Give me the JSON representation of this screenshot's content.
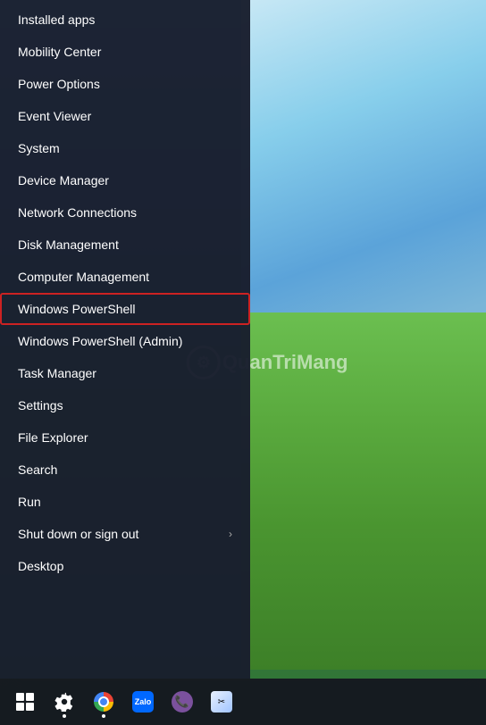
{
  "desktop": {
    "watermark_text": "QuanTriMang"
  },
  "context_menu": {
    "items": [
      {
        "id": "installed-apps",
        "label": "Installed apps",
        "arrow": false,
        "highlighted": false
      },
      {
        "id": "mobility-center",
        "label": "Mobility Center",
        "arrow": false,
        "highlighted": false
      },
      {
        "id": "power-options",
        "label": "Power Options",
        "arrow": false,
        "highlighted": false
      },
      {
        "id": "event-viewer",
        "label": "Event Viewer",
        "arrow": false,
        "highlighted": false
      },
      {
        "id": "system",
        "label": "System",
        "arrow": false,
        "highlighted": false
      },
      {
        "id": "device-manager",
        "label": "Device Manager",
        "arrow": false,
        "highlighted": false
      },
      {
        "id": "network-connections",
        "label": "Network Connections",
        "arrow": false,
        "highlighted": false
      },
      {
        "id": "disk-management",
        "label": "Disk Management",
        "arrow": false,
        "highlighted": false
      },
      {
        "id": "computer-management",
        "label": "Computer Management",
        "arrow": false,
        "highlighted": false
      },
      {
        "id": "windows-powershell",
        "label": "Windows PowerShell",
        "arrow": false,
        "highlighted": true
      },
      {
        "id": "windows-powershell-admin",
        "label": "Windows PowerShell (Admin)",
        "arrow": false,
        "highlighted": false
      },
      {
        "id": "task-manager",
        "label": "Task Manager",
        "arrow": false,
        "highlighted": false
      },
      {
        "id": "settings",
        "label": "Settings",
        "arrow": false,
        "highlighted": false
      },
      {
        "id": "file-explorer",
        "label": "File Explorer",
        "arrow": false,
        "highlighted": false
      },
      {
        "id": "search",
        "label": "Search",
        "arrow": false,
        "highlighted": false
      },
      {
        "id": "run",
        "label": "Run",
        "arrow": false,
        "highlighted": false
      },
      {
        "id": "shut-down",
        "label": "Shut down or sign out",
        "arrow": true,
        "highlighted": false
      },
      {
        "id": "desktop",
        "label": "Desktop",
        "arrow": false,
        "highlighted": false
      }
    ]
  },
  "taskbar": {
    "icons": [
      {
        "id": "start",
        "type": "windows",
        "label": "Start",
        "has_dot": false
      },
      {
        "id": "settings",
        "type": "gear",
        "label": "Settings",
        "has_dot": true
      },
      {
        "id": "chrome",
        "type": "chrome",
        "label": "Google Chrome",
        "has_dot": true
      },
      {
        "id": "zalo",
        "type": "zalo",
        "label": "Zalo",
        "has_dot": false
      },
      {
        "id": "viber",
        "type": "viber",
        "label": "Viber",
        "has_dot": false
      },
      {
        "id": "app",
        "type": "app",
        "label": "App",
        "has_dot": false
      }
    ]
  }
}
